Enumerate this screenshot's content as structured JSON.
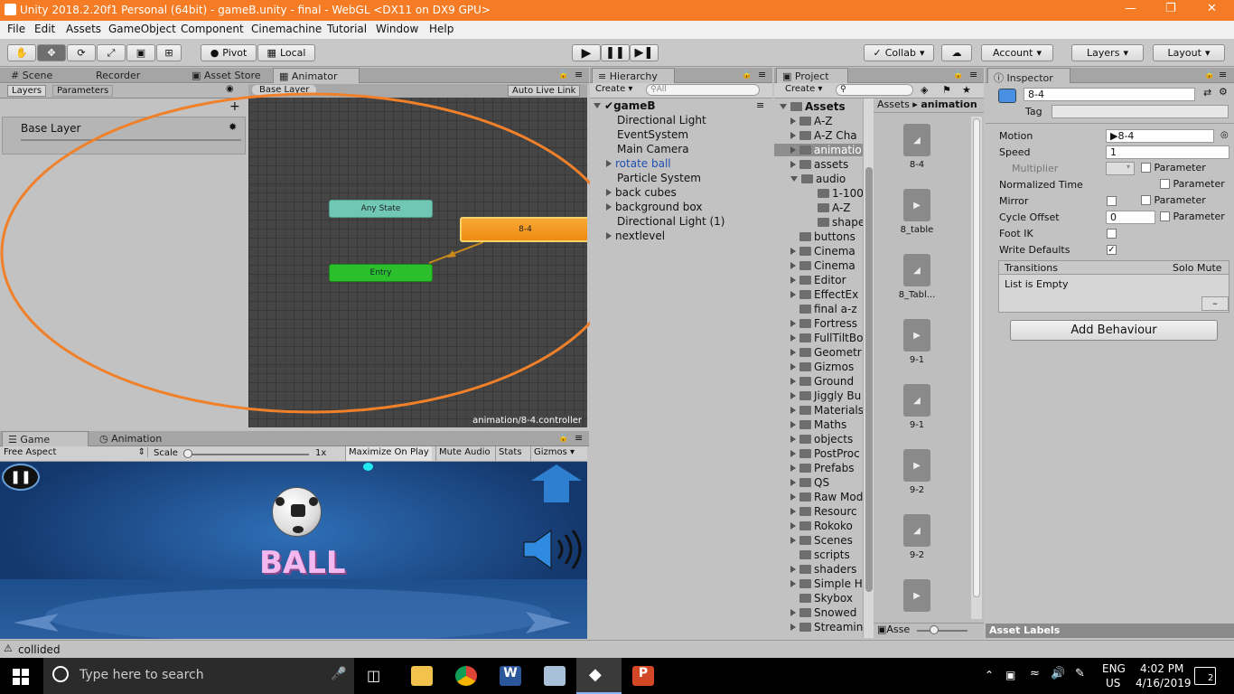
{
  "window": {
    "title": "Unity 2018.2.20f1 Personal (64bit) - gameB.unity - final - WebGL <DX11 on DX9 GPU>"
  },
  "menu": [
    "File",
    "Edit",
    "Assets",
    "GameObject",
    "Component",
    "Cinemachine",
    "Tutorial",
    "Window",
    "Help"
  ],
  "toolbar": {
    "pivot": "Pivot",
    "local": "Local",
    "collab": "Collab",
    "account": "Account",
    "layers": "Layers",
    "layout": "Layout"
  },
  "scene_tabs": [
    "Scene",
    "Recorder",
    "Asset Store",
    "Animator"
  ],
  "animator": {
    "subtabs": [
      "Layers",
      "Parameters"
    ],
    "layer_name": "Base Layer",
    "breadcrumb": "Base Layer",
    "auto_live_link": "Auto Live Link",
    "states": {
      "any": "Any State",
      "entry": "Entry",
      "motion": "8-4"
    },
    "controller_path": "animation/8-4.controller"
  },
  "game": {
    "tabs": [
      "Game",
      "Animation"
    ],
    "aspect": "Free Aspect",
    "scale_label": "Scale",
    "scale_value": "1x",
    "buttons": [
      "Maximize On Play",
      "Mute Audio",
      "Stats",
      "Gizmos"
    ],
    "ball_text": "BALL"
  },
  "hierarchy": {
    "tab": "Hierarchy",
    "create": "Create",
    "search_placeholder": "All",
    "scene": "gameB",
    "items": [
      "Directional Light",
      "EventSystem",
      "Main Camera",
      "rotate ball",
      "Particle System",
      "back cubes",
      "background box",
      "Directional Light (1)",
      "nextlevel"
    ]
  },
  "project": {
    "tab": "Project",
    "create": "Create",
    "root": "Assets",
    "folders": [
      "A-Z",
      "A-Z Cha",
      "animatio",
      "assets",
      "audio",
      "1-100",
      "A-Z",
      "shape",
      "buttons",
      "Cinema",
      "Cinema",
      "Editor",
      "EffectEx",
      "final a-z",
      "Fortress",
      "FullTiltBo",
      "Geometr",
      "Gizmos",
      "Ground",
      "Jiggly Bu",
      "Materials",
      "Maths",
      "objects",
      "PostProc",
      "Prefabs",
      "QS",
      "Raw Mod",
      "Resourc",
      "Rokoko",
      "Scenes",
      "scripts",
      "shaders",
      "Simple H",
      "Skybox",
      "Snowed",
      "Streamin"
    ],
    "breadcrumb": [
      "Assets",
      "animation"
    ],
    "assets": [
      "8-4",
      "8_table",
      "8_Tabl...",
      "9-1",
      "9-1",
      "9-2",
      "9-2",
      ""
    ],
    "footer_label": "Asse"
  },
  "inspector": {
    "tab": "Inspector",
    "name": "8-4",
    "tag_label": "Tag",
    "motion_label": "Motion",
    "motion_value": "8-4",
    "speed_label": "Speed",
    "speed_value": "1",
    "multiplier_label": "Multiplier",
    "normalized_time_label": "Normalized Time",
    "mirror_label": "Mirror",
    "cycle_offset_label": "Cycle Offset",
    "cycle_offset_value": "0",
    "foot_ik_label": "Foot IK",
    "write_defaults_label": "Write Defaults",
    "parameter_label": "Parameter",
    "transitions_label": "Transitions",
    "solo_mute": "Solo Mute",
    "list_empty": "List is Empty",
    "add_behaviour": "Add Behaviour",
    "asset_labels": "Asset Labels"
  },
  "status": {
    "message": "collided"
  },
  "taskbar": {
    "search_placeholder": "Type here to search",
    "lang1": "ENG",
    "lang2": "US",
    "time": "4:02 PM",
    "date": "4/16/2019",
    "notif_count": "2"
  },
  "colors": {
    "titlebar": "#f57c24",
    "motion_state": "#f39a1e",
    "entry_state": "#2cbf2c",
    "any_state": "#6fc7b4",
    "annotation_ellipse": "#f0812a"
  }
}
